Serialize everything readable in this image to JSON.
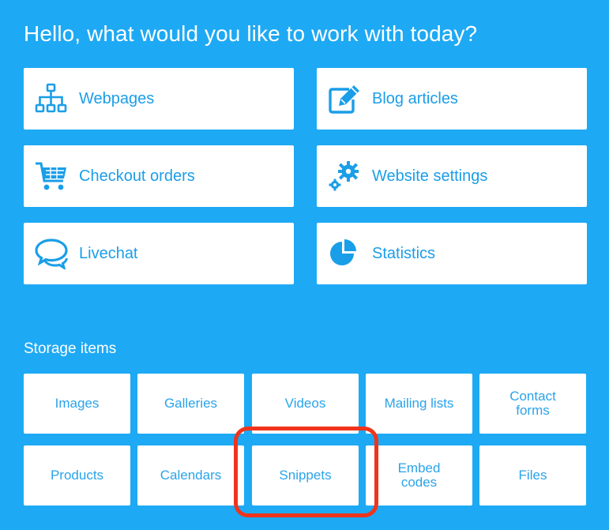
{
  "heading": "Hello, what would you like to work with today?",
  "tiles": [
    {
      "label": "Webpages",
      "icon": "sitemap-icon"
    },
    {
      "label": "Blog articles",
      "icon": "edit-icon"
    },
    {
      "label": "Checkout orders",
      "icon": "cart-icon"
    },
    {
      "label": "Website settings",
      "icon": "gears-icon"
    },
    {
      "label": "Livechat",
      "icon": "chat-bubbles-icon"
    },
    {
      "label": "Statistics",
      "icon": "pie-chart-icon"
    }
  ],
  "storage": {
    "title": "Storage items",
    "items": [
      {
        "label": "Images"
      },
      {
        "label": "Galleries"
      },
      {
        "label": "Videos"
      },
      {
        "label": "Mailing lists"
      },
      {
        "label": "Contact\nforms"
      },
      {
        "label": "Products"
      },
      {
        "label": "Calendars"
      },
      {
        "label": "Snippets"
      },
      {
        "label": "Embed\ncodes"
      },
      {
        "label": "Files"
      }
    ]
  },
  "colors": {
    "background": "#1ea9f4",
    "tile": "#ffffff",
    "accent_text": "#1a9ee8",
    "highlight": "#f0341c"
  }
}
